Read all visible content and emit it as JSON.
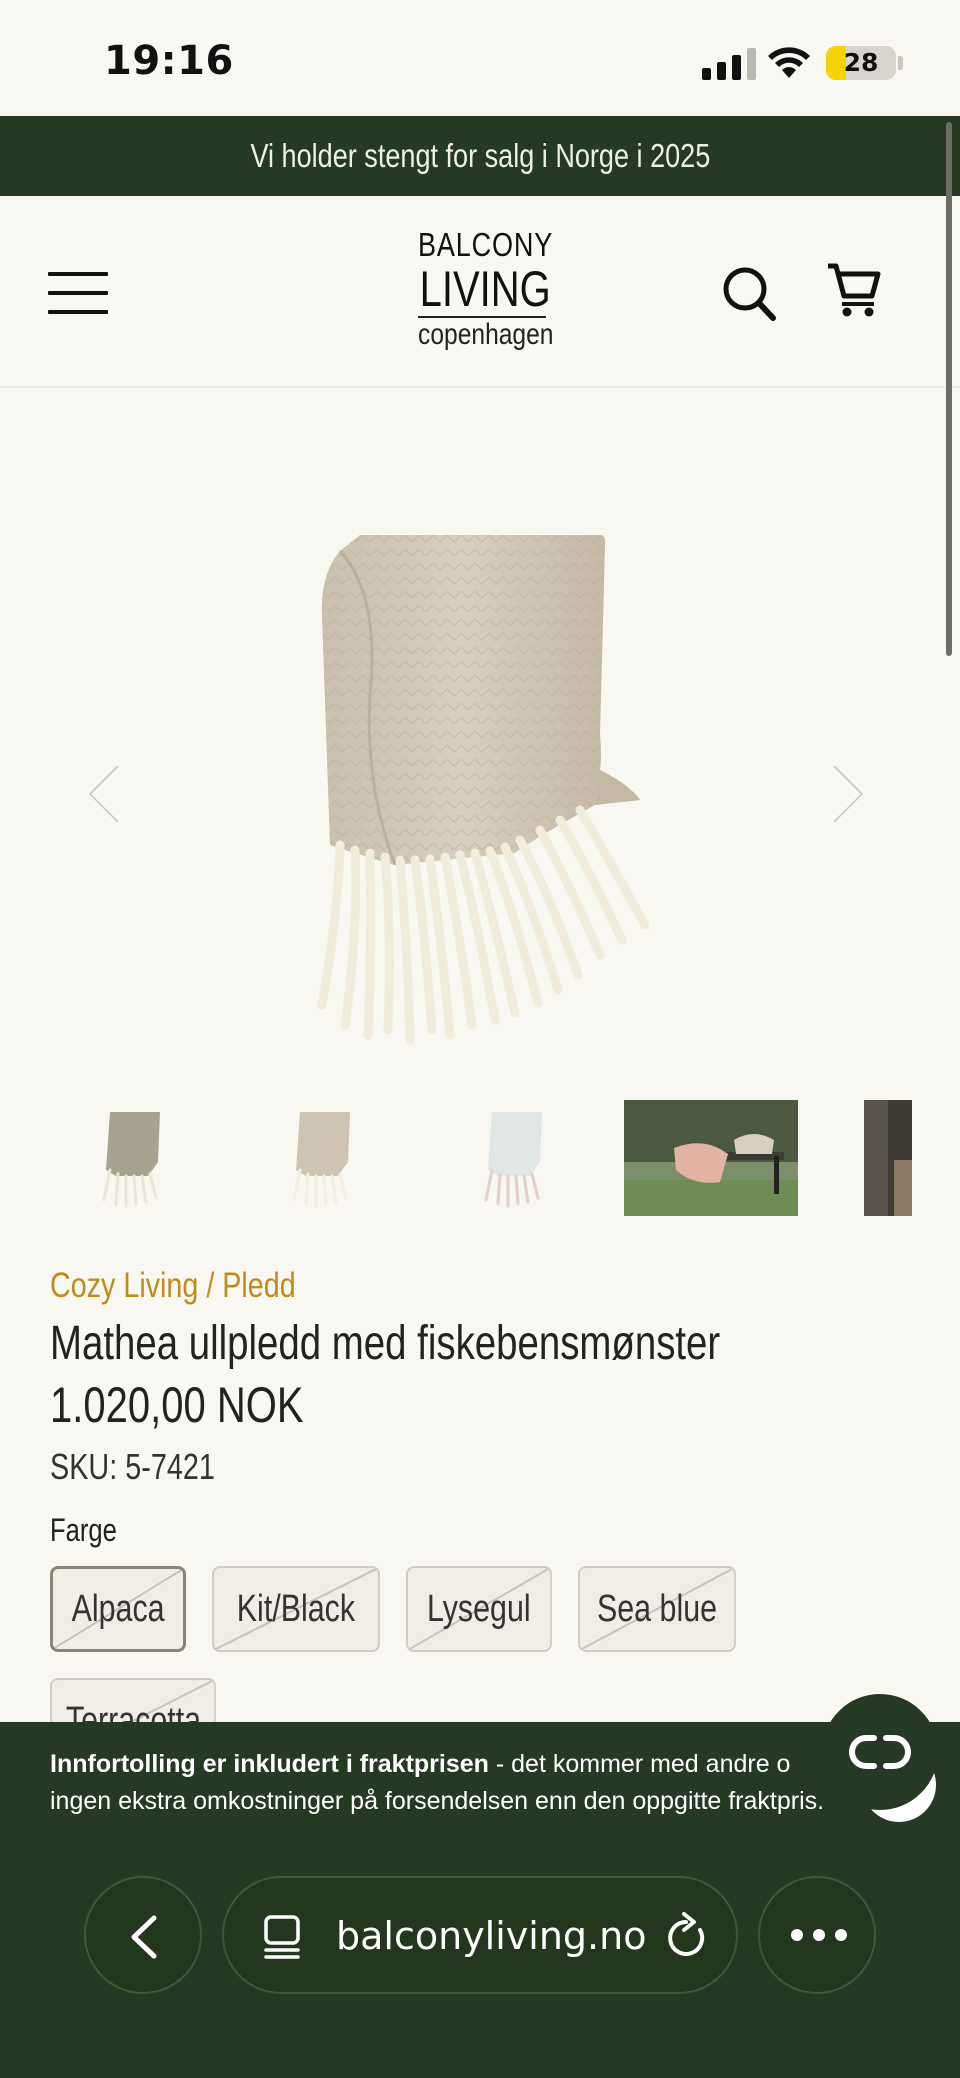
{
  "status_bar": {
    "time": "19:16",
    "battery": "28",
    "battery_level": 0.28
  },
  "announcement": "Vi holder stengt for salg i Norge i 2025",
  "header": {
    "logo": {
      "line1": "BALCONY",
      "line2": "LIVING",
      "line3": "copenhagen"
    },
    "menu_icon": "menu-icon",
    "search_icon": "search-icon",
    "cart_icon": "cart-icon"
  },
  "product": {
    "breadcrumb": "Cozy Living / Pledd",
    "title": "Mathea ullpledd med fiskebensmønster",
    "price": "1.020,00 NOK",
    "sku": "SKU: 5-7421",
    "color_label": "Farge",
    "colors": [
      "Alpaca",
      "Kit/Black",
      "Lysegul",
      "Sea blue",
      "Terracotta"
    ],
    "selected_color": "Alpaca"
  },
  "notice": {
    "bold": "Innfortolling er inkludert i fraktprisen",
    "line1_rest": " - det kommer med andre o",
    "line2": "ingen ekstra omkostninger på forsendelsen enn den oppgitte fraktpris."
  },
  "browser": {
    "url": "balconyliving.no"
  },
  "colors": {
    "brand_green": "#253924",
    "accent_gold": "#bf8c1c",
    "background": "#f8f7f1"
  }
}
